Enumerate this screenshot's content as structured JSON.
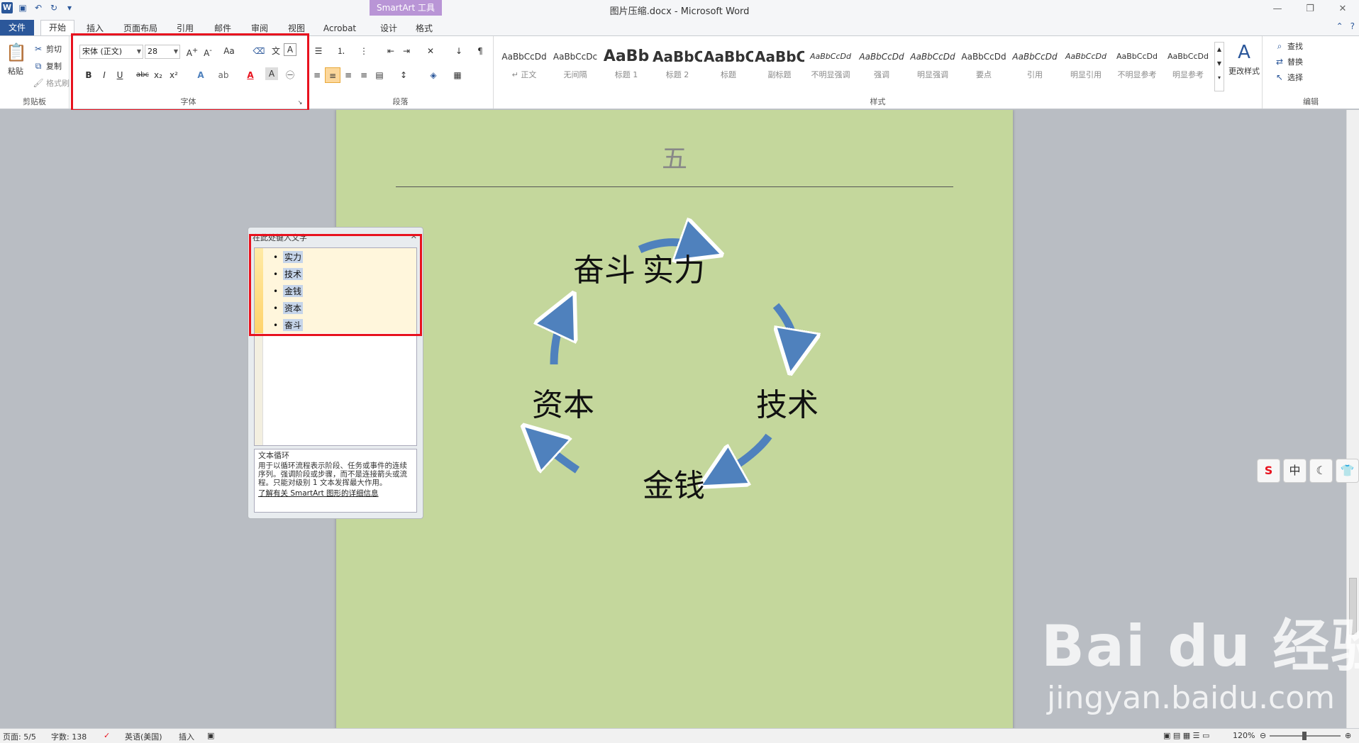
{
  "titlebar": {
    "title": "图片压缩.docx - Microsoft Word",
    "context_tab_group": "SmartArt 工具"
  },
  "tabs": {
    "file": "文件",
    "home": "开始",
    "insert": "插入",
    "layout": "页面布局",
    "references": "引用",
    "mailings": "邮件",
    "review": "审阅",
    "view": "视图",
    "acrobat": "Acrobat",
    "design": "设计",
    "format": "格式"
  },
  "ribbon": {
    "clipboard": {
      "label": "剪贴板",
      "paste": "粘贴",
      "cut": "剪切",
      "copy": "复制",
      "format_painter": "格式刷"
    },
    "font": {
      "label": "字体",
      "font_name": "宋体 (正文)",
      "font_size": "28"
    },
    "paragraph": {
      "label": "段落"
    },
    "styles": {
      "label": "样式",
      "items": [
        {
          "sample": "AaBbCcDd",
          "name": "↵ 正文"
        },
        {
          "sample": "AaBbCcDc",
          "name": "无间隔"
        },
        {
          "sample": "AaBb",
          "name": "标题 1"
        },
        {
          "sample": "AaBbC",
          "name": "标题 2"
        },
        {
          "sample": "AaBbC",
          "name": "标题"
        },
        {
          "sample": "AaBbC",
          "name": "副标题"
        },
        {
          "sample": "AaBbCcDd",
          "name": "不明显强调"
        },
        {
          "sample": "AaBbCcDd",
          "name": "强调"
        },
        {
          "sample": "AaBbCcDd",
          "name": "明显强调"
        },
        {
          "sample": "AaBbCcDd",
          "name": "要点"
        },
        {
          "sample": "AaBbCcDd",
          "name": "引用"
        },
        {
          "sample": "AaBbCcDd",
          "name": "明显引用"
        },
        {
          "sample": "AaBbCcDd",
          "name": "不明显参考"
        },
        {
          "sample": "AaBbCcDd",
          "name": "明显参考"
        }
      ],
      "change_styles": "更改样式"
    },
    "editing": {
      "label": "编辑",
      "find": "查找",
      "replace": "替换",
      "select": "选择"
    }
  },
  "document": {
    "heading": "五",
    "smartart_nodes": [
      "实力",
      "技术",
      "金钱",
      "资本",
      "奋斗"
    ],
    "accent_color": "#4f81bd"
  },
  "text_pane": {
    "title": "在此处键入文字",
    "items": [
      "实力",
      "技术",
      "金钱",
      "资本",
      "奋斗"
    ],
    "desc_title": "文本循环",
    "desc_body": "用于以循环流程表示阶段、任务或事件的连续序列。强调阶段或步骤，而不是连接箭头或流程。只能对级别 1 文本发挥最大作用。",
    "link": "了解有关 SmartArt 图形的详细信息"
  },
  "ime": {
    "lang": "中"
  },
  "statusbar": {
    "page": "页面: 5/5",
    "words": "字数: 138",
    "language": "英语(美国)",
    "mode": "插入",
    "zoom": "120%"
  },
  "watermark": {
    "brand": "Bai du 经验",
    "url": "jingyan.baidu.com"
  }
}
